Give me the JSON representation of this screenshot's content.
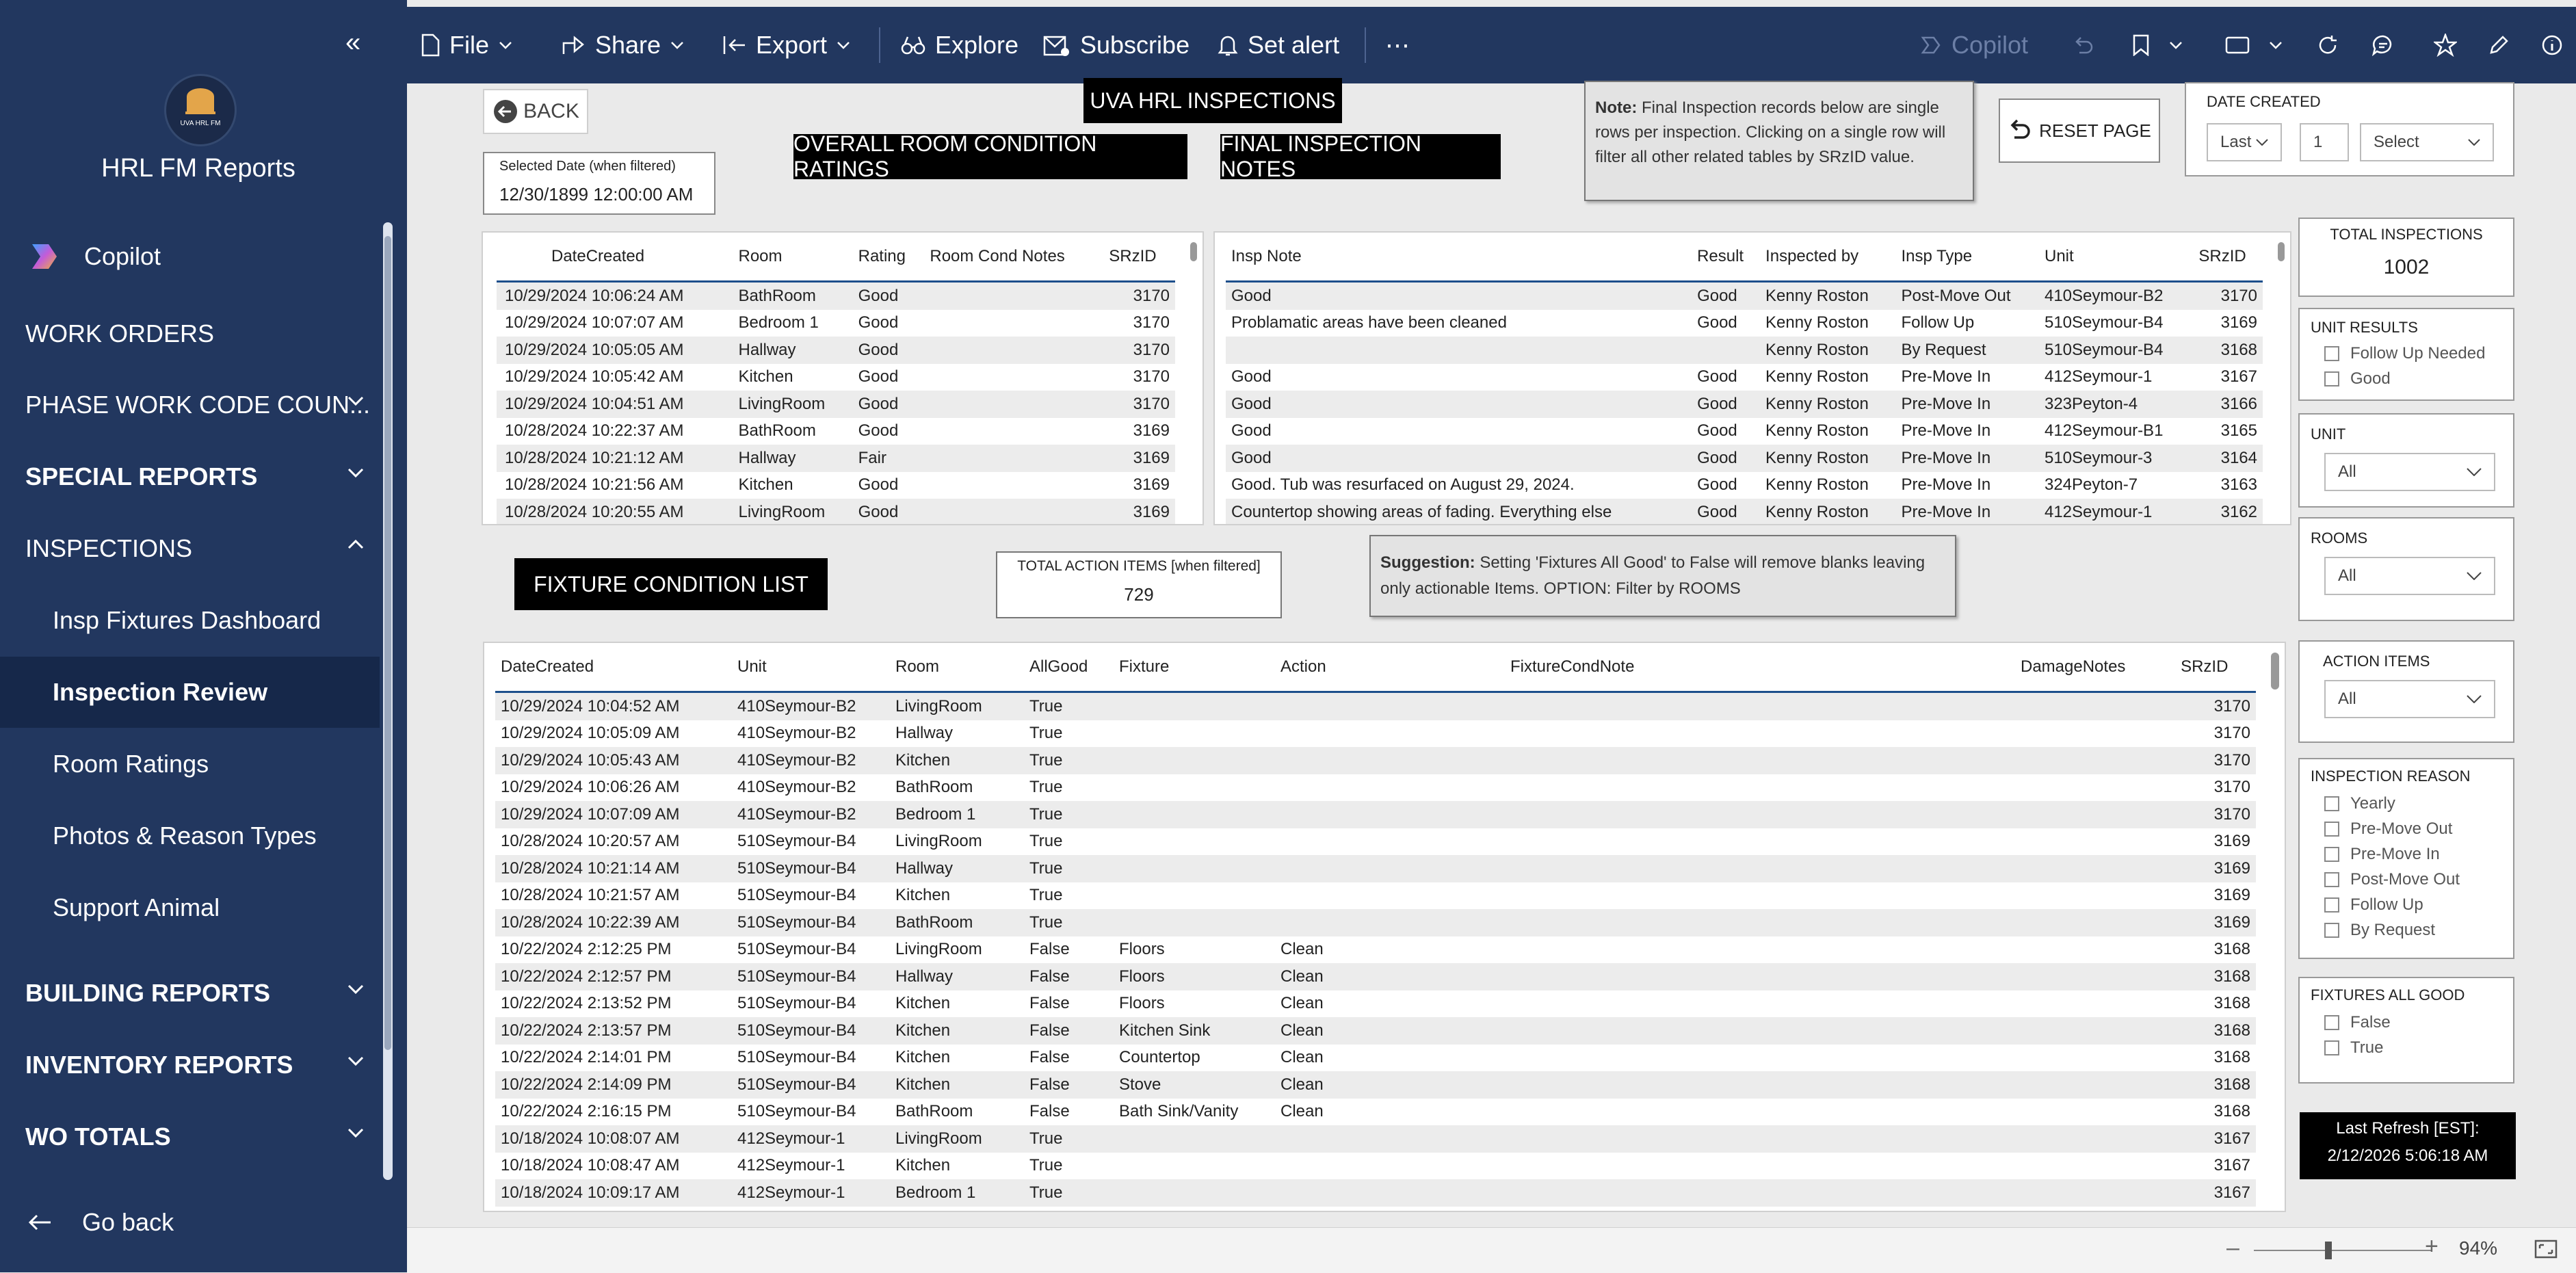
{
  "sidebar": {
    "app_name": "HRL FM Reports",
    "logo_text": "UVA HRL FM",
    "copilot": "Copilot",
    "items": [
      {
        "label": "WORK ORDERS"
      },
      {
        "label": "PHASE WORK CODE COUN..."
      },
      {
        "label": "SPECIAL REPORTS"
      },
      {
        "label": "INSPECTIONS"
      },
      {
        "label": "Insp Fixtures Dashboard"
      },
      {
        "label": "Inspection Review"
      },
      {
        "label": "Room Ratings"
      },
      {
        "label": "Photos & Reason Types"
      },
      {
        "label": "Support Animal"
      },
      {
        "label": "BUILDING REPORTS"
      },
      {
        "label": "INVENTORY REPORTS"
      },
      {
        "label": "WO TOTALS"
      }
    ],
    "go_back": "Go back"
  },
  "topbar": {
    "file": "File",
    "share": "Share",
    "export": "Export",
    "explore": "Explore",
    "subscribe": "Subscribe",
    "set_alert": "Set alert",
    "more": "⋯",
    "copilot": "Copilot"
  },
  "report": {
    "back": "BACK",
    "title": "UVA HRL INSPECTIONS",
    "overall_btn": "OVERALL ROOM CONDITION RATINGS",
    "final_btn": "FINAL INSPECTION NOTES",
    "selected_date_label": "Selected Date (when filtered)",
    "selected_date_value": "12/30/1899 12:00:00 AM",
    "note_bold": "Note:",
    "note_text": "Final Inspection records below are single rows per inspection. Clicking on a single row will filter all other related tables by SRzID value.",
    "reset": "RESET PAGE",
    "date_created_label": "DATE CREATED",
    "date_last": "Last",
    "date_num": "1",
    "date_select": "Select",
    "fixture_list_btn": "FIXTURE CONDITION LIST",
    "total_action_label": "TOTAL ACTION ITEMS [when filtered]",
    "total_action_value": "729",
    "suggestion_bold": "Suggestion:",
    "suggestion_text": "Setting 'Fixtures All Good' to False will remove blanks leaving only actionable Items. OPTION: Filter by ROOMS"
  },
  "room_table": {
    "headers": [
      "DateCreated",
      "Room",
      "Rating",
      "Room Cond Notes",
      "SRzID"
    ],
    "rows": [
      [
        "10/29/2024 10:06:24 AM",
        "BathRoom",
        "Good",
        "",
        "3170"
      ],
      [
        "10/29/2024 10:07:07 AM",
        "Bedroom 1",
        "Good",
        "",
        "3170"
      ],
      [
        "10/29/2024 10:05:05 AM",
        "Hallway",
        "Good",
        "",
        "3170"
      ],
      [
        "10/29/2024 10:05:42 AM",
        "Kitchen",
        "Good",
        "",
        "3170"
      ],
      [
        "10/29/2024 10:04:51 AM",
        "LivingRoom",
        "Good",
        "",
        "3170"
      ],
      [
        "10/28/2024 10:22:37 AM",
        "BathRoom",
        "Good",
        "",
        "3169"
      ],
      [
        "10/28/2024 10:21:12 AM",
        "Hallway",
        "Fair",
        "",
        "3169"
      ],
      [
        "10/28/2024 10:21:56 AM",
        "Kitchen",
        "Good",
        "",
        "3169"
      ],
      [
        "10/28/2024 10:20:55 AM",
        "LivingRoom",
        "Good",
        "",
        "3169"
      ]
    ]
  },
  "insp_table": {
    "headers": [
      "Insp Note",
      "Result",
      "Inspected by",
      "Insp Type",
      "Unit",
      "SRzID"
    ],
    "rows": [
      [
        "Good",
        "Good",
        "Kenny Roston",
        "Post-Move Out",
        "410Seymour-B2",
        "3170"
      ],
      [
        "Problamatic areas have been cleaned",
        "Good",
        "Kenny Roston",
        "Follow Up",
        "510Seymour-B4",
        "3169"
      ],
      [
        "",
        "",
        "Kenny Roston",
        "By Request",
        "510Seymour-B4",
        "3168"
      ],
      [
        "Good",
        "Good",
        "Kenny Roston",
        "Pre-Move In",
        "412Seymour-1",
        "3167"
      ],
      [
        "Good",
        "Good",
        "Kenny Roston",
        "Pre-Move In",
        "323Peyton-4",
        "3166"
      ],
      [
        "Good",
        "Good",
        "Kenny Roston",
        "Pre-Move In",
        "412Seymour-B1",
        "3165"
      ],
      [
        "Good",
        "Good",
        "Kenny Roston",
        "Pre-Move In",
        "510Seymour-3",
        "3164"
      ],
      [
        "Good. Tub was resurfaced on August 29, 2024.",
        "Good",
        "Kenny Roston",
        "Pre-Move In",
        "324Peyton-7",
        "3163"
      ],
      [
        "Countertop showing areas of fading. Everything else",
        "Good",
        "Kenny Roston",
        "Pre-Move In",
        "412Seymour-1",
        "3162"
      ]
    ]
  },
  "fixture_table": {
    "headers": [
      "DateCreated",
      "Unit",
      "Room",
      "AllGood",
      "Fixture",
      "Action",
      "FixtureCondNote",
      "DamageNotes",
      "SRzID"
    ],
    "rows": [
      [
        "10/29/2024 10:04:52 AM",
        "410Seymour-B2",
        "LivingRoom",
        "True",
        "",
        "",
        "",
        "",
        "3170"
      ],
      [
        "10/29/2024 10:05:09 AM",
        "410Seymour-B2",
        "Hallway",
        "True",
        "",
        "",
        "",
        "",
        "3170"
      ],
      [
        "10/29/2024 10:05:43 AM",
        "410Seymour-B2",
        "Kitchen",
        "True",
        "",
        "",
        "",
        "",
        "3170"
      ],
      [
        "10/29/2024 10:06:26 AM",
        "410Seymour-B2",
        "BathRoom",
        "True",
        "",
        "",
        "",
        "",
        "3170"
      ],
      [
        "10/29/2024 10:07:09 AM",
        "410Seymour-B2",
        "Bedroom 1",
        "True",
        "",
        "",
        "",
        "",
        "3170"
      ],
      [
        "10/28/2024 10:20:57 AM",
        "510Seymour-B4",
        "LivingRoom",
        "True",
        "",
        "",
        "",
        "",
        "3169"
      ],
      [
        "10/28/2024 10:21:14 AM",
        "510Seymour-B4",
        "Hallway",
        "True",
        "",
        "",
        "",
        "",
        "3169"
      ],
      [
        "10/28/2024 10:21:57 AM",
        "510Seymour-B4",
        "Kitchen",
        "True",
        "",
        "",
        "",
        "",
        "3169"
      ],
      [
        "10/28/2024 10:22:39 AM",
        "510Seymour-B4",
        "BathRoom",
        "True",
        "",
        "",
        "",
        "",
        "3169"
      ],
      [
        "10/22/2024 2:12:25 PM",
        "510Seymour-B4",
        "LivingRoom",
        "False",
        "Floors",
        "Clean",
        "",
        "",
        "3168"
      ],
      [
        "10/22/2024 2:12:57 PM",
        "510Seymour-B4",
        "Hallway",
        "False",
        "Floors",
        "Clean",
        "",
        "",
        "3168"
      ],
      [
        "10/22/2024 2:13:52 PM",
        "510Seymour-B4",
        "Kitchen",
        "False",
        "Floors",
        "Clean",
        "",
        "",
        "3168"
      ],
      [
        "10/22/2024 2:13:57 PM",
        "510Seymour-B4",
        "Kitchen",
        "False",
        "Kitchen Sink",
        "Clean",
        "",
        "",
        "3168"
      ],
      [
        "10/22/2024 2:14:01 PM",
        "510Seymour-B4",
        "Kitchen",
        "False",
        "Countertop",
        "Clean",
        "",
        "",
        "3168"
      ],
      [
        "10/22/2024 2:14:09 PM",
        "510Seymour-B4",
        "Kitchen",
        "False",
        "Stove",
        "Clean",
        "",
        "",
        "3168"
      ],
      [
        "10/22/2024 2:16:15 PM",
        "510Seymour-B4",
        "BathRoom",
        "False",
        "Bath Sink/Vanity",
        "Clean",
        "",
        "",
        "3168"
      ],
      [
        "10/18/2024 10:08:07 AM",
        "412Seymour-1",
        "LivingRoom",
        "True",
        "",
        "",
        "",
        "",
        "3167"
      ],
      [
        "10/18/2024 10:08:47 AM",
        "412Seymour-1",
        "Kitchen",
        "True",
        "",
        "",
        "",
        "",
        "3167"
      ],
      [
        "10/18/2024 10:09:17 AM",
        "412Seymour-1",
        "Bedroom 1",
        "True",
        "",
        "",
        "",
        "",
        "3167"
      ]
    ]
  },
  "right_panel": {
    "total_insp_label": "TOTAL INSPECTIONS",
    "total_insp_value": "1002",
    "unit_results_label": "UNIT RESULTS",
    "unit_results": [
      "Follow Up Needed",
      "Good"
    ],
    "unit_label": "UNIT",
    "unit_value": "All",
    "rooms_label": "ROOMS",
    "rooms_value": "All",
    "action_items_label": "ACTION ITEMS",
    "action_items_value": "All",
    "insp_reason_label": "INSPECTION REASON",
    "insp_reasons": [
      "Yearly",
      "Pre-Move Out",
      "Pre-Move In",
      "Post-Move Out",
      "Follow Up",
      "By Request"
    ],
    "fixtures_good_label": "FIXTURES ALL GOOD",
    "fixtures_good": [
      "False",
      "True"
    ],
    "last_refresh_label": "Last Refresh [EST]:",
    "last_refresh_value": "2/12/2026 5:06:18 AM"
  },
  "footer": {
    "zoom_minus": "–",
    "zoom_plus": "+",
    "zoom": "94%",
    "zoom_level": 0.42
  },
  "colors": {
    "sidebar": "#22375f",
    "active": "#16284a",
    "header_underline": "#1d4f8c"
  }
}
